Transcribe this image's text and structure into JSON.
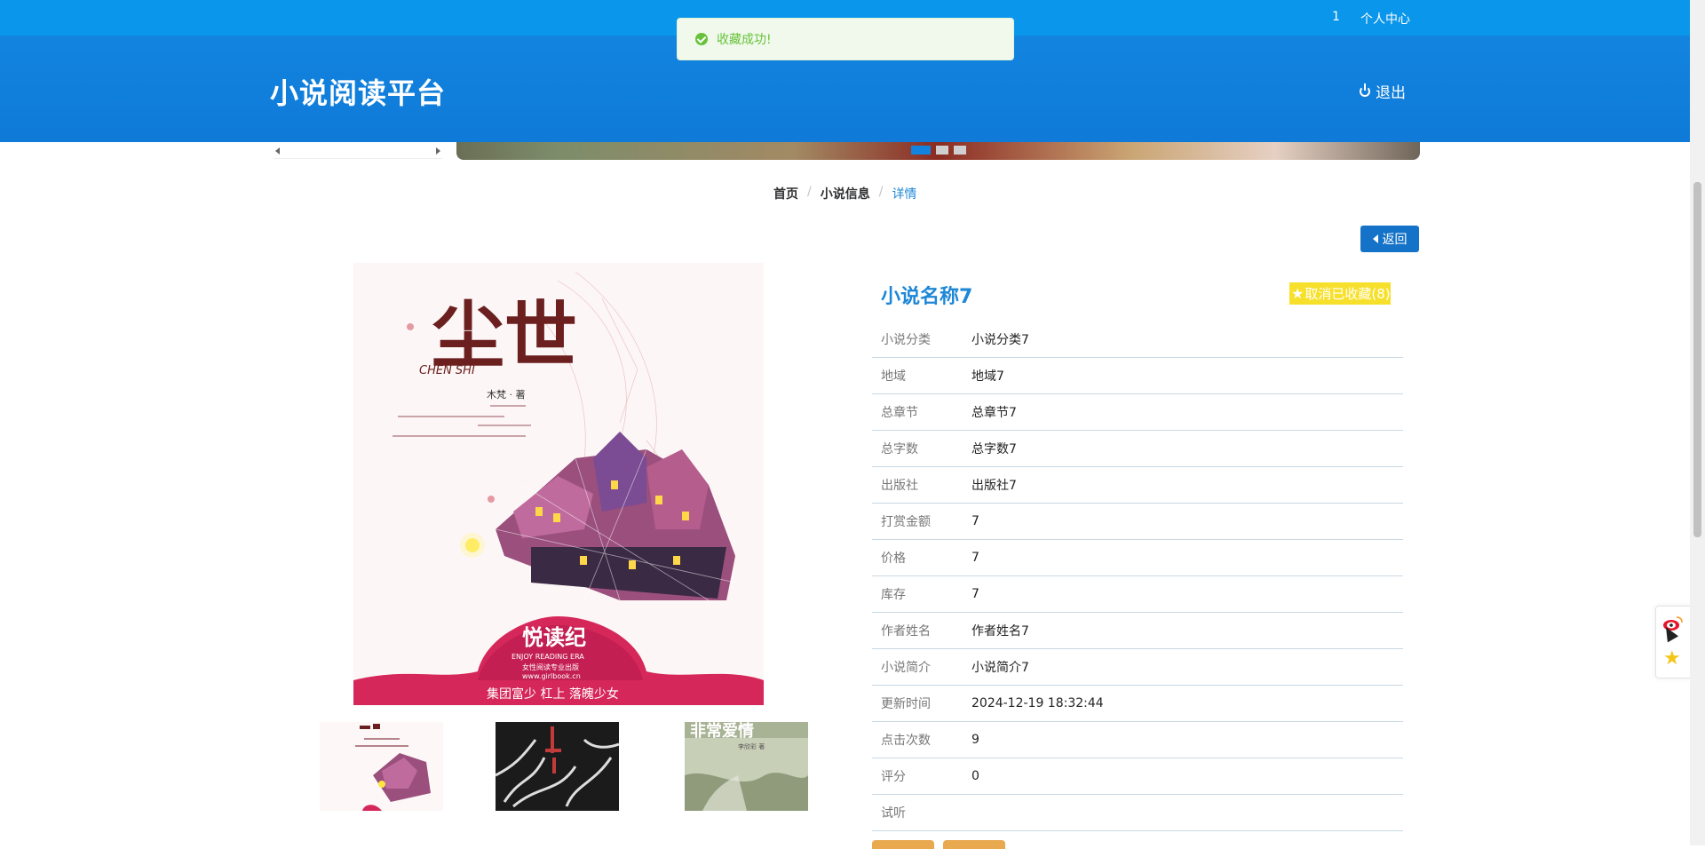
{
  "topbar": {
    "count": "1",
    "user_center": "个人中心"
  },
  "header": {
    "brand": "小说阅读平台",
    "logout": "退出"
  },
  "toast": {
    "message": "收藏成功!"
  },
  "breadcrumb": {
    "home": "首页",
    "section": "小说信息",
    "current": "详情"
  },
  "back_button": "返回",
  "novel": {
    "title": "小说名称7",
    "favorite_label": "取消已收藏(8)",
    "fields": [
      {
        "label": "小说分类",
        "value": "小说分类7"
      },
      {
        "label": "地域",
        "value": "地域7"
      },
      {
        "label": "总章节",
        "value": "总章节7"
      },
      {
        "label": "总字数",
        "value": "总字数7"
      },
      {
        "label": "出版社",
        "value": "出版社7"
      },
      {
        "label": "打赏金额",
        "value": "7"
      },
      {
        "label": "价格",
        "value": "7"
      },
      {
        "label": "库存",
        "value": "7"
      },
      {
        "label": "作者姓名",
        "value": "作者姓名7"
      },
      {
        "label": "小说简介",
        "value": "小说简介7"
      },
      {
        "label": "更新时间",
        "value": "2024-12-19 18:32:44"
      },
      {
        "label": "点击次数",
        "value": "9"
      },
      {
        "label": "评分",
        "value": "0"
      },
      {
        "label": "试听",
        "value": ""
      }
    ]
  },
  "cover": {
    "title_cn": "尘世",
    "title_pinyin": "CHEN SHI",
    "author_line": "木梵 · 著",
    "banner": "悦读纪",
    "banner_en": "ENJOY READING ERA",
    "banner_sub": "女性阅读专业出版",
    "banner_url": "www.girlbook.cn",
    "bottom_line": "集团富少 杠上 落魄少女"
  },
  "thumb3": {
    "title": "非常爱情",
    "author": "李欣彩 著"
  },
  "colors": {
    "brand_blue": "#1284df",
    "accent_yellow": "#f7e02b",
    "success_green": "#67c23a"
  }
}
